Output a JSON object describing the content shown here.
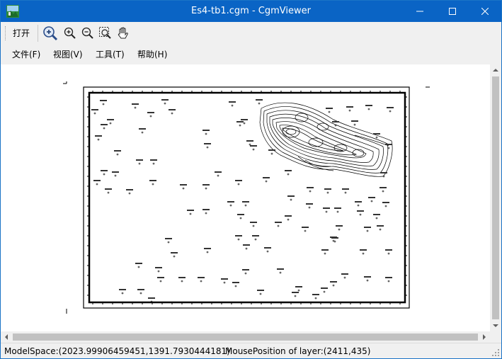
{
  "window": {
    "title": "Es4-tb1.cgm - CgmViewer"
  },
  "toolbar": {
    "open_label": "打开",
    "icons": [
      "zoom-in-area-icon",
      "zoom-in-icon",
      "zoom-out-icon",
      "zoom-extent-icon",
      "pan-hand-icon"
    ]
  },
  "menu": {
    "items": [
      {
        "label": "文件(F)"
      },
      {
        "label": "视图(V)"
      },
      {
        "label": "工具(T)"
      },
      {
        "label": "帮助(H)"
      }
    ]
  },
  "status": {
    "model_space": "ModelSpace:(2023.99906459451,1391.7930444181)",
    "mouse_position": "MousePosition of layer:(2411,435)"
  }
}
